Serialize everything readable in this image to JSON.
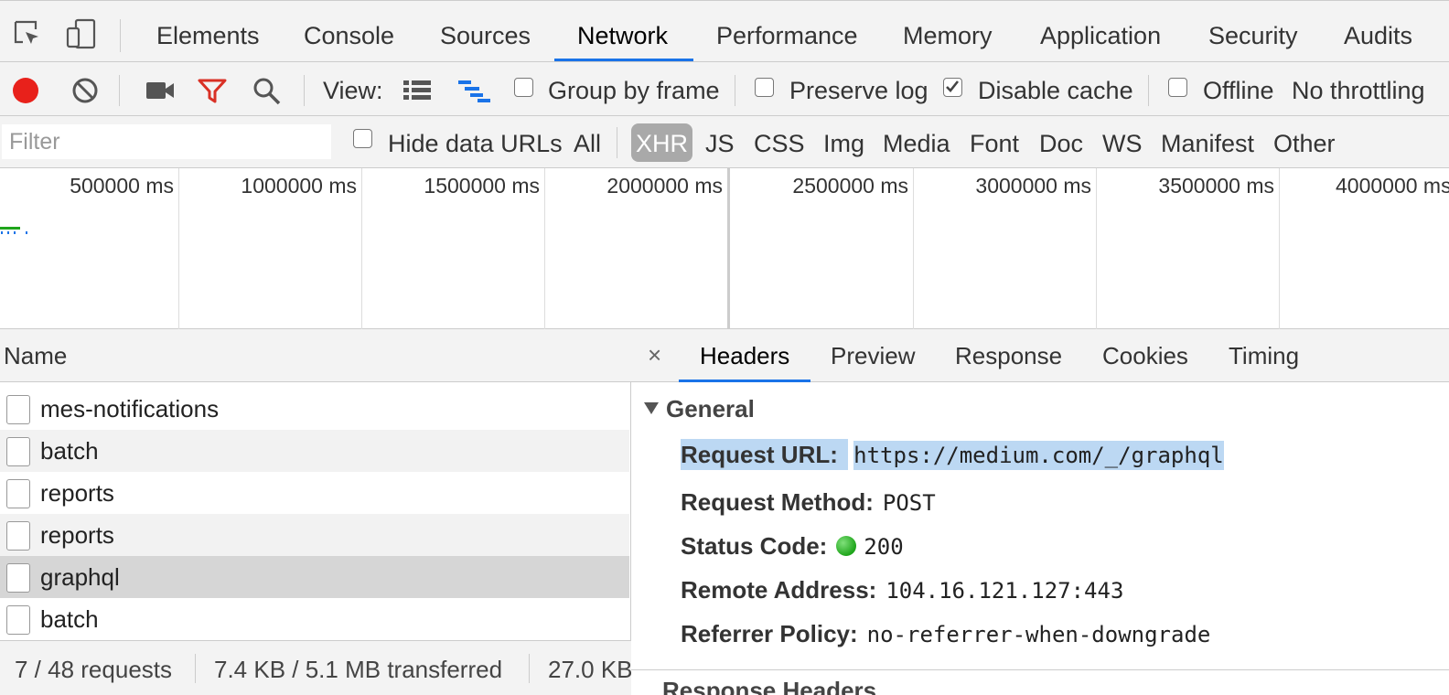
{
  "tabs": {
    "items": [
      "Elements",
      "Console",
      "Sources",
      "Network",
      "Performance",
      "Memory",
      "Application",
      "Security",
      "Audits"
    ],
    "active": "Network"
  },
  "toolbar": {
    "view_label": "View:",
    "group_by_frame": {
      "label": "Group by frame",
      "checked": false
    },
    "preserve_log": {
      "label": "Preserve log",
      "checked": false
    },
    "disable_cache": {
      "label": "Disable cache",
      "checked": true
    },
    "offline": {
      "label": "Offline",
      "checked": false
    },
    "throttling": "No throttling",
    "record_color": "#e8211b",
    "filter_icon_color": "#d93025"
  },
  "filterbar": {
    "filter_placeholder": "Filter",
    "hide_data_urls": {
      "label": "Hide data URLs",
      "checked": false
    },
    "types": [
      "All",
      "XHR",
      "JS",
      "CSS",
      "Img",
      "Media",
      "Font",
      "Doc",
      "WS",
      "Manifest",
      "Other"
    ],
    "active_type": "XHR"
  },
  "overview": {
    "ticks": [
      "500000 ms",
      "1000000 ms",
      "1500000 ms",
      "2000000 ms",
      "2500000 ms",
      "3000000 ms",
      "3500000 ms",
      "4000000 ms"
    ]
  },
  "request_list": {
    "column_name": "Name",
    "rows": [
      {
        "name": "mes-notifications",
        "selected": false
      },
      {
        "name": "batch",
        "selected": false
      },
      {
        "name": "reports",
        "selected": false
      },
      {
        "name": "reports",
        "selected": false
      },
      {
        "name": "graphql",
        "selected": true
      },
      {
        "name": "batch",
        "selected": false
      }
    ],
    "summary": {
      "requests": "7 / 48 requests",
      "transferred": "7.4 KB / 5.1 MB transferred",
      "resources": "27.0 KB"
    }
  },
  "details": {
    "close_glyph": "×",
    "tabs": [
      "Headers",
      "Preview",
      "Response",
      "Cookies",
      "Timing"
    ],
    "active_tab": "Headers",
    "general": {
      "title": "General",
      "request_url_key": "Request URL:",
      "request_url": "https://medium.com/_/graphql",
      "request_method_key": "Request Method:",
      "request_method": "POST",
      "status_code_key": "Status Code:",
      "status_code": "200",
      "remote_address_key": "Remote Address:",
      "remote_address": "104.16.121.127:443",
      "referrer_policy_key": "Referrer Policy:",
      "referrer_policy": "no-referrer-when-downgrade"
    },
    "next_section": "Response Headers",
    "status_color": "#1fa51b",
    "highlight_color": "#bcd8f3"
  }
}
